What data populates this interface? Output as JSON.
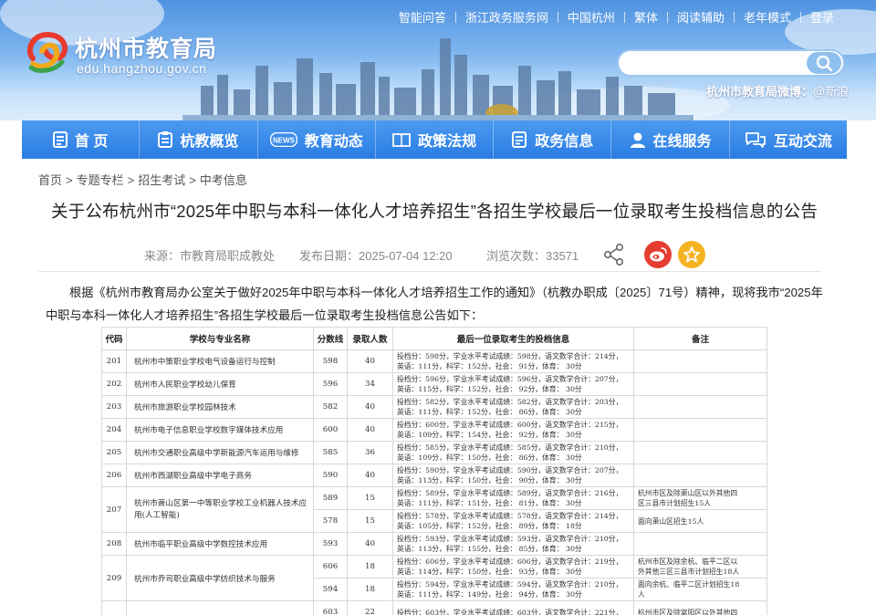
{
  "site": {
    "title": "杭州市教育局",
    "domain": "edu.hangzhou.gov.cn",
    "top_links": [
      "智能问答",
      "浙江政务服务网",
      "中国杭州",
      "繁体",
      "阅读辅助",
      "老年模式",
      "登录"
    ],
    "search_placeholder": "",
    "weibo_label": "杭州市教育局微博：",
    "weibo_handle": "@新浪"
  },
  "nav": [
    {
      "label": "首 页",
      "icon": "home-doc-icon"
    },
    {
      "label": "杭教概览",
      "icon": "clipboard-icon"
    },
    {
      "label": "教育动态",
      "icon": "news-icon"
    },
    {
      "label": "政策法规",
      "icon": "book-icon"
    },
    {
      "label": "政务信息",
      "icon": "document-icon"
    },
    {
      "label": "在线服务",
      "icon": "service-person-icon"
    },
    {
      "label": "互动交流",
      "icon": "chat-bubbles-icon"
    }
  ],
  "breadcrumb": [
    "首页",
    "专题专栏",
    "招生考试",
    "中考信息"
  ],
  "article": {
    "title": "关于公布杭州市“2025年中职与本科一体化人才培养招生”各招生学校最后一位录取考生投档信息的公告",
    "source": "来源：市教育局职成教处",
    "publish_date": "发布日期：2025-07-04 12:20",
    "views": "浏览次数：33571",
    "intro": "根据《杭州市教育局办公室关于做好2025年中职与本科一体化人才培养招生工作的通知》（杭教办职成〔2025〕71号）精神，现将我市“2025年中职与本科一体化人才培养招生”各招生学校最后一位录取考生投档信息公告如下："
  },
  "table": {
    "headers": [
      "代码",
      "学校与专业名称",
      "分数线",
      "录取人数",
      "最后一位录取考生的投档信息",
      "备注"
    ],
    "rows": [
      {
        "code": "201",
        "name": "杭州市中策职业学校电气设备运行与控制",
        "line": "598",
        "num": "40",
        "info1": "投档分：598分，学业水平考试成绩：598分，语文数学合计：214分，",
        "info2": "英语：111分，科学：152分，社会：  91分，体育：  30分",
        "note1": "",
        "note2": ""
      },
      {
        "code": "202",
        "name": "杭州市人民职业学校幼儿保育",
        "line": "596",
        "num": "34",
        "info1": "投档分：596分，学业水平考试成绩：596分，语文数学合计：207分，",
        "info2": "英语：115分，科学：152分，社会：  92分，体育：  30分",
        "note1": "",
        "note2": ""
      },
      {
        "code": "203",
        "name": "杭州市旅游职业学校园林技术",
        "line": "582",
        "num": "40",
        "info1": "投档分：582分，学业水平考试成绩：582分，语文数学合计：203分，",
        "info2": "英语：111分，科学：152分，社会：  86分，体育：  30分",
        "note1": "",
        "note2": ""
      },
      {
        "code": "204",
        "name": "杭州市电子信息职业学校数字媒体技术应用",
        "line": "600",
        "num": "40",
        "info1": "投档分：600分，学业水平考试成绩：600分，语文数学合计：215分，",
        "info2": "英语：109分，科学：154分，社会：  92分，体育：  30分",
        "note1": "",
        "note2": ""
      },
      {
        "code": "205",
        "name": "杭州市交通职业高级中学新能源汽车运用与维修",
        "line": "585",
        "num": "36",
        "info1": "投档分：585分，学业水平考试成绩：585分，语文数学合计：210分，",
        "info2": "英语：109分，科学：150分，社会：  86分，体育：  30分",
        "note1": "",
        "note2": ""
      },
      {
        "code": "206",
        "name": "杭州市西湖职业高级中学电子商务",
        "line": "590",
        "num": "40",
        "info1": "投档分：590分，学业水平考试成绩：590分，语文数学合计：207分，",
        "info2": "英语：113分，科学：150分，社会：  90分，体育：  30分",
        "note1": "",
        "note2": ""
      },
      {
        "code": "207",
        "name": "杭州市萧山区第一中等职业学校工业机器人技术应用(人工智能)",
        "line": "589",
        "num": "15",
        "info1": "投档分：589分，学业水平考试成绩：589分，语文数学合计：216分，",
        "info2": "英语：111分，科学：151分，社会：  81分，体育：  30分",
        "note1": "杭州市区及除萧山区以外其他四",
        "note2": "区三县市计划招生15人"
      },
      {
        "code": "",
        "name": "",
        "line": "578",
        "num": "15",
        "info1": "投档分：578分，学业水平考试成绩：578分，语文数学合计：214分，",
        "info2": "英语：105分，科学：152分，社会：  89分，体育：  18分",
        "note1": "面向萧山区招生15人",
        "note2": ""
      },
      {
        "code": "208",
        "name": "杭州市临平职业高级中学数控技术应用",
        "line": "593",
        "num": "40",
        "info1": "投档分：593分，学业水平考试成绩：593分，语文数学合计：210分，",
        "info2": "英语：113分，科学：155分，社会：  85分，体育：  30分",
        "note1": "",
        "note2": ""
      },
      {
        "code": "209",
        "name": "杭州市乔司职业高级中学纺织技术与服务",
        "line": "606",
        "num": "18",
        "info1": "投档分：606分，学业水平考试成绩：606分，语文数学合计：219分，",
        "info2": "英语：114分，科学：150分，社会：  93分，体育：  30分",
        "note1": "杭州市区及除余杭、临平二区以",
        "note2": "外其他三区三县市计划招生18人"
      },
      {
        "code": "",
        "name": "",
        "line": "594",
        "num": "18",
        "info1": "投档分：594分，学业水平考试成绩：594分，语文数学合计：210分，",
        "info2": "英语：111分，科学：149分，社会：  94分，体育：  30分",
        "note1": "面向余杭、临平二区计划招生18",
        "note2": "人"
      },
      {
        "code": "",
        "name": "",
        "line": "603",
        "num": "22",
        "info1": "投档分：603分，学业水平考试成绩：603分，语文数学合计：221分，",
        "info2": "",
        "note1": "杭州市区及除富阳区以外其他四",
        "note2": ""
      }
    ]
  },
  "colors": {
    "nav_bg": "#2a7ce4",
    "header_sky": "#4f92e0",
    "weibo_red": "#e53d2f",
    "fav_gold": "#f5b221"
  }
}
